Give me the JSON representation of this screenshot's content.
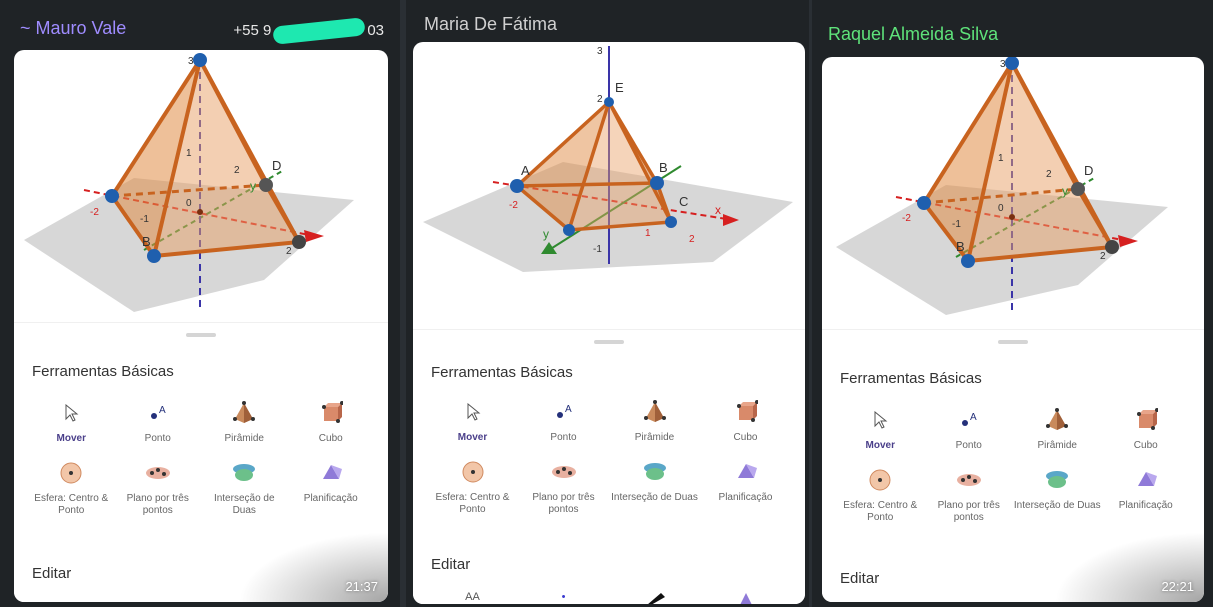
{
  "panels": [
    {
      "name": "~ Mauro Vale",
      "name_color": "#9f8cff",
      "phone_prefix": "+55 9",
      "phone_suffix": "03",
      "tools_title": "Ferramentas Básicas",
      "tools": [
        {
          "label": "Mover",
          "icon": "cursor-icon"
        },
        {
          "label": "Ponto",
          "icon": "point-icon"
        },
        {
          "label": "Pirâmide",
          "icon": "pyramid-icon"
        },
        {
          "label": "Cubo",
          "icon": "cube-icon"
        },
        {
          "label": "Esfera: Centro & Ponto",
          "icon": "sphere-icon"
        },
        {
          "label": "Plano por três pontos",
          "icon": "plane-icon"
        },
        {
          "label": "Interseção de Duas",
          "icon": "intersection-icon"
        },
        {
          "label": "Planificação",
          "icon": "net-icon"
        }
      ],
      "edit_label": "Editar",
      "time": "21:37",
      "scene_labels": {
        "axis_top": "3",
        "z1": "1",
        "z2": "2",
        "vertex_b": "B",
        "vertex_d": "D",
        "tick_m2": "-2",
        "tick_m1": "-1",
        "tick_0": "0",
        "tick_2": "2",
        "axis_y": "y"
      }
    },
    {
      "name": "Maria De Fátima",
      "name_color": "#d0d0d0",
      "tools_title": "Ferramentas Básicas",
      "tools": [
        {
          "label": "Mover",
          "icon": "cursor-icon"
        },
        {
          "label": "Ponto",
          "icon": "point-icon"
        },
        {
          "label": "Pirâmide",
          "icon": "pyramid-icon"
        },
        {
          "label": "Cubo",
          "icon": "cube-icon"
        },
        {
          "label": "Esfera: Centro & Ponto",
          "icon": "sphere-icon"
        },
        {
          "label": "Plano por três pontos",
          "icon": "plane-icon"
        },
        {
          "label": "Interseção de Duas",
          "icon": "intersection-icon"
        },
        {
          "label": "Planificação",
          "icon": "net-icon"
        }
      ],
      "edit_label": "Editar",
      "extra_row": [
        "AA",
        "•",
        "",
        ""
      ],
      "scene_labels": {
        "axis_top": "3",
        "z2": "2",
        "vertex_e": "E",
        "vertex_a": "A",
        "vertex_b": "B",
        "vertex_c": "C",
        "axis_x": "x",
        "axis_y": "y",
        "tick_m2": "-2",
        "tick_m1": "-1",
        "tick_1": "1",
        "tick_2": "2"
      }
    },
    {
      "name": "Raquel Almeida Silva",
      "name_color": "#5ee27a",
      "tools_title": "Ferramentas Básicas",
      "tools": [
        {
          "label": "Mover",
          "icon": "cursor-icon"
        },
        {
          "label": "Ponto",
          "icon": "point-icon"
        },
        {
          "label": "Pirâmide",
          "icon": "pyramid-icon"
        },
        {
          "label": "Cubo",
          "icon": "cube-icon"
        },
        {
          "label": "Esfera: Centro & Ponto",
          "icon": "sphere-icon"
        },
        {
          "label": "Plano por três pontos",
          "icon": "plane-icon"
        },
        {
          "label": "Interseção de Duas",
          "icon": "intersection-icon"
        },
        {
          "label": "Planificação",
          "icon": "net-icon"
        }
      ],
      "edit_label": "Editar",
      "time": "22:21",
      "scene_labels": {
        "axis_top": "3",
        "z1": "1",
        "z2": "2",
        "vertex_b": "B",
        "vertex_d": "D",
        "tick_m2": "-2",
        "tick_m1": "-1",
        "tick_0": "0",
        "tick_2": "2",
        "axis_y": "y"
      }
    }
  ]
}
